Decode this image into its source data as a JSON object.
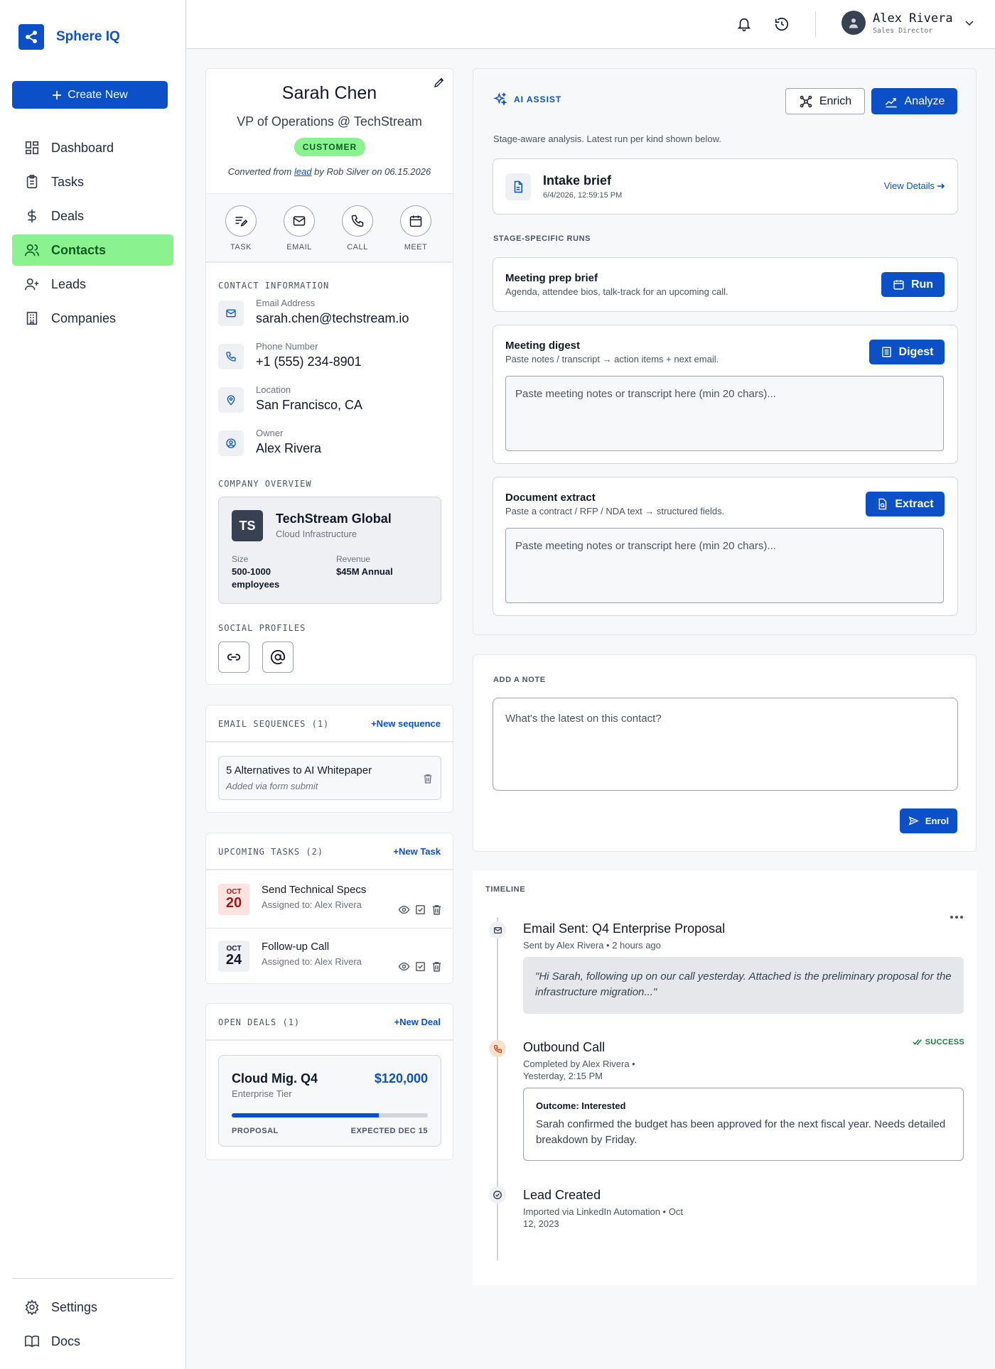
{
  "app": {
    "name": "Sphere IQ",
    "create_label": "Create New"
  },
  "nav": [
    {
      "label": "Dashboard",
      "icon": "dashboard-icon"
    },
    {
      "label": "Tasks",
      "icon": "clipboard-icon"
    },
    {
      "label": "Deals",
      "icon": "dollar-icon"
    },
    {
      "label": "Contacts",
      "icon": "users-icon",
      "active": true
    },
    {
      "label": "Leads",
      "icon": "user-plus-icon"
    },
    {
      "label": "Companies",
      "icon": "building-icon"
    }
  ],
  "nav_bottom": [
    {
      "label": "Settings",
      "icon": "gear-icon"
    },
    {
      "label": "Docs",
      "icon": "book-icon"
    }
  ],
  "user": {
    "name": "Alex Rivera",
    "role": "Sales Director"
  },
  "contact": {
    "name": "Sarah Chen",
    "title": "VP of Operations @ TechStream",
    "status": "CUSTOMER",
    "converted_prefix": "Converted from",
    "converted_link": "lead",
    "converted_suffix": "by Rob Silver on 06.15.2026",
    "actions": [
      "TASK",
      "EMAIL",
      "CALL",
      "MEET"
    ],
    "info_label": "CONTACT INFORMATION",
    "email_label": "Email Address",
    "email": "sarah.chen@techstream.io",
    "phone_label": "Phone Number",
    "phone": "+1 (555) 234-8901",
    "location_label": "Location",
    "location": "San Francisco, CA",
    "owner_label": "Owner",
    "owner": "Alex Rivera"
  },
  "company": {
    "section": "COMPANY OVERVIEW",
    "initials": "TS",
    "name": "TechStream Global",
    "industry": "Cloud Infrastructure",
    "size_label": "Size",
    "size": "500-1000 employees",
    "revenue_label": "Revenue",
    "revenue": "$45M Annual"
  },
  "social": {
    "section": "SOCIAL PROFILES"
  },
  "sequences": {
    "header": "EMAIL SEQUENCES (1)",
    "new_label": "+New sequence",
    "items": [
      {
        "title": "5 Alternatives to AI Whitepaper",
        "sub": "Added via form submit"
      }
    ]
  },
  "tasks": {
    "header": "UPCOMING TASKS (2)",
    "new_label": "+New Task",
    "items": [
      {
        "month": "OCT",
        "day": "20",
        "title": "Send Technical Specs",
        "sub": "Assigned to: Alex Rivera",
        "urgent": true
      },
      {
        "month": "OCT",
        "day": "24",
        "title": "Follow-up Call",
        "sub": "Assigned to: Alex Rivera",
        "urgent": false
      }
    ]
  },
  "deals": {
    "header": "OPEN DEALS (1)",
    "new_label": "+New Deal",
    "items": [
      {
        "name": "Cloud Mig. Q4",
        "value": "$120,000",
        "tier": "Enterprise Tier",
        "stage": "PROPOSAL",
        "expected": "EXPECTED DEC 15",
        "progress": 0.75
      }
    ]
  },
  "ai": {
    "header": "AI ASSIST",
    "enrich_label": "Enrich",
    "analyze_label": "Analyze",
    "description": "Stage-aware analysis. Latest run per kind shown below.",
    "intake_title": "Intake brief",
    "intake_date": "6/4/2026, 12:59:15 PM",
    "view_details": "View Details",
    "stage_label": "STAGE-SPECIFIC RUNS",
    "prep_title": "Meeting prep brief",
    "prep_sub": "Agenda, attendee bios, talk-track for an upcoming call.",
    "run_label": "Run",
    "digest_title": "Meeting digest",
    "digest_sub": "Paste notes / transcript → action items + next email.",
    "digest_label": "Digest",
    "digest_placeholder": "Paste meeting notes or transcript here (min 20 chars)...",
    "extract_title": "Document extract",
    "extract_sub": "Paste a contract / RFP / NDA text → structured fields.",
    "extract_label": "Extract",
    "extract_placeholder": "Paste meeting notes or transcript here (min 20 chars)..."
  },
  "note": {
    "label": "ADD A NOTE",
    "placeholder": "What's the latest on this contact?",
    "submit_label": "Enrol"
  },
  "timeline": {
    "label": "TIMELINE",
    "email_title": "Email Sent: Q4 Enterprise Proposal",
    "email_sub": "Sent by Alex Rivera • 2 hours ago",
    "email_quote": "\"Hi Sarah, following up on our call yesterday. Attached is the preliminary proposal for the infrastructure migration...\"",
    "call_title": "Outbound Call",
    "call_sub1": "Completed by Alex Rivera •",
    "call_sub2": "Yesterday, 2:15 PM",
    "call_status": "SUCCESS",
    "outcome_head": "Outcome: Interested",
    "outcome_body": "Sarah confirmed the budget has been approved for the next fiscal year. Needs detailed breakdown by Friday.",
    "lead_title": "Lead Created",
    "lead_sub1": "Imported via LinkedIn Automation • Oct",
    "lead_sub2": "12, 2023"
  },
  "colors": {
    "primary": "#0b50c9",
    "active_nav": "#8af28f",
    "success": "#15803d",
    "urgent_bg": "#fde2e2"
  }
}
